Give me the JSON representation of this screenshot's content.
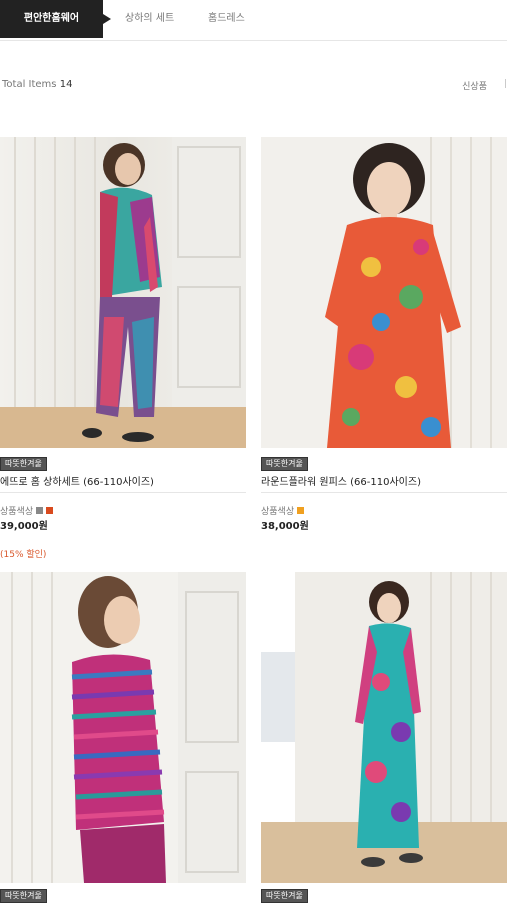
{
  "tabs": [
    {
      "label": "편안한홈웨어",
      "active": true
    },
    {
      "label": "상하의 세트",
      "active": false
    },
    {
      "label": "홈드레스",
      "active": false
    }
  ],
  "toolbar": {
    "total_label": "Total Items",
    "total_count": "14",
    "sort_label": "신상품"
  },
  "products": [
    {
      "tag": "따뜻한겨울",
      "name": "에뜨로 홈 상하세트 (66-110사이즈)",
      "colors_label": "상품색상",
      "swatches": [
        "#888888",
        "#d94a1e"
      ],
      "price": "39,000원",
      "discount": "(15% 할인)"
    },
    {
      "tag": "따뜻한겨울",
      "name": "라운드플라워 원피스 (66-110사이즈)",
      "colors_label": "상품색상",
      "swatches": [
        "#f0a020"
      ],
      "price": "38,000원"
    },
    {
      "tag": "따뜻한겨울"
    },
    {
      "tag": "따뜻한겨울"
    }
  ],
  "colors": {
    "active_tab_bg": "#222222",
    "discount": "#d9572b",
    "tag_bg": "#555555"
  }
}
